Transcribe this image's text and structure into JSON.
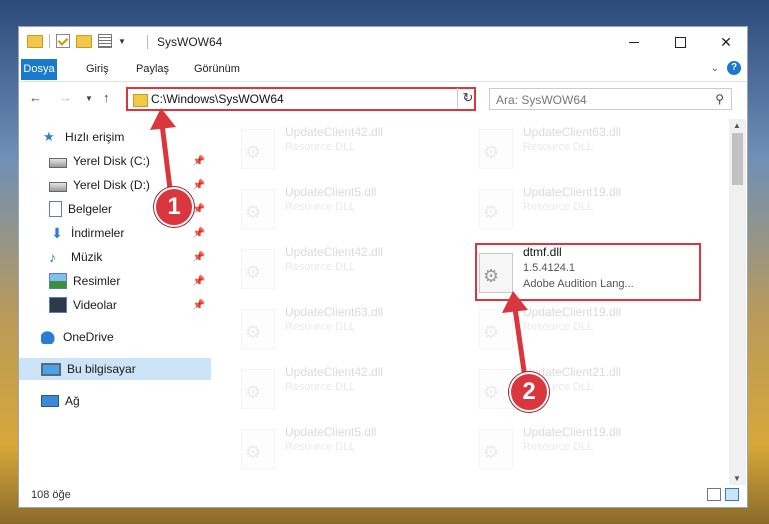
{
  "window": {
    "title": "SysWOW64",
    "minimize_icon": "minimize-icon",
    "maximize_icon": "maximize-icon",
    "close_icon": "close-icon"
  },
  "ribbon": {
    "tabs": [
      {
        "label": "Dosya",
        "active": true
      },
      {
        "label": "Giriş"
      },
      {
        "label": "Paylaş"
      },
      {
        "label": "Görünüm"
      }
    ],
    "help_label": "?"
  },
  "navigation": {
    "address_path": "C:\\Windows\\SysWOW64",
    "search_placeholder": "Ara: SysWOW64"
  },
  "sidebar": {
    "items": [
      {
        "label": "Hızlı erişim",
        "icon": "star-icon"
      },
      {
        "label": "Yerel Disk (C:)",
        "icon": "disk-icon",
        "pinned": true
      },
      {
        "label": "Yerel Disk (D:)",
        "icon": "disk-icon",
        "pinned": true
      },
      {
        "label": "Belgeler",
        "icon": "document-icon",
        "pinned": true
      },
      {
        "label": "İndirmeler",
        "icon": "download-icon",
        "pinned": true
      },
      {
        "label": "Müzik",
        "icon": "music-icon",
        "pinned": true
      },
      {
        "label": "Resimler",
        "icon": "pictures-icon",
        "pinned": true
      },
      {
        "label": "Videolar",
        "icon": "videos-icon",
        "pinned": true
      },
      {
        "label": "OneDrive",
        "icon": "cloud-icon"
      },
      {
        "label": "Bu bilgisayar",
        "icon": "computer-icon",
        "selected": true
      },
      {
        "label": "Ağ",
        "icon": "network-icon"
      }
    ]
  },
  "files": {
    "left_column": [
      {
        "name": "UpdateClient42.dll",
        "desc": "Resource DLL"
      },
      {
        "name": "UpdateClient5.dll",
        "desc": "Resource DLL"
      },
      {
        "name": "UpdateClient42.dll",
        "desc": "Resource DLL"
      },
      {
        "name": "UpdateClient63.dll",
        "desc": "Resource DLL"
      },
      {
        "name": "UpdateClient42.dll",
        "desc": "Resource DLL"
      },
      {
        "name": "UpdateClient5.dll",
        "desc": "Resource DLL"
      }
    ],
    "right_column": [
      {
        "name": "UpdateClient63.dll",
        "desc": "Resource DLL"
      },
      {
        "name": "UpdateClient19.dll",
        "desc": "Resource DLL"
      },
      {
        "name": "UpdateClient19.dll",
        "desc": "Resource DLL"
      },
      {
        "name": "UpdateClient21.dll",
        "desc": "Resource DLL"
      },
      {
        "name": "UpdateClient19.dll",
        "desc": "Resource DLL"
      }
    ],
    "highlighted": {
      "name": "dtmf.dll",
      "version": "1.5.4124.1",
      "desc": "Adobe Audition Lang..."
    }
  },
  "status": {
    "item_count": "108 öğe"
  },
  "annotations": {
    "step1": "1",
    "step2": "2",
    "color": "#d9363e"
  }
}
